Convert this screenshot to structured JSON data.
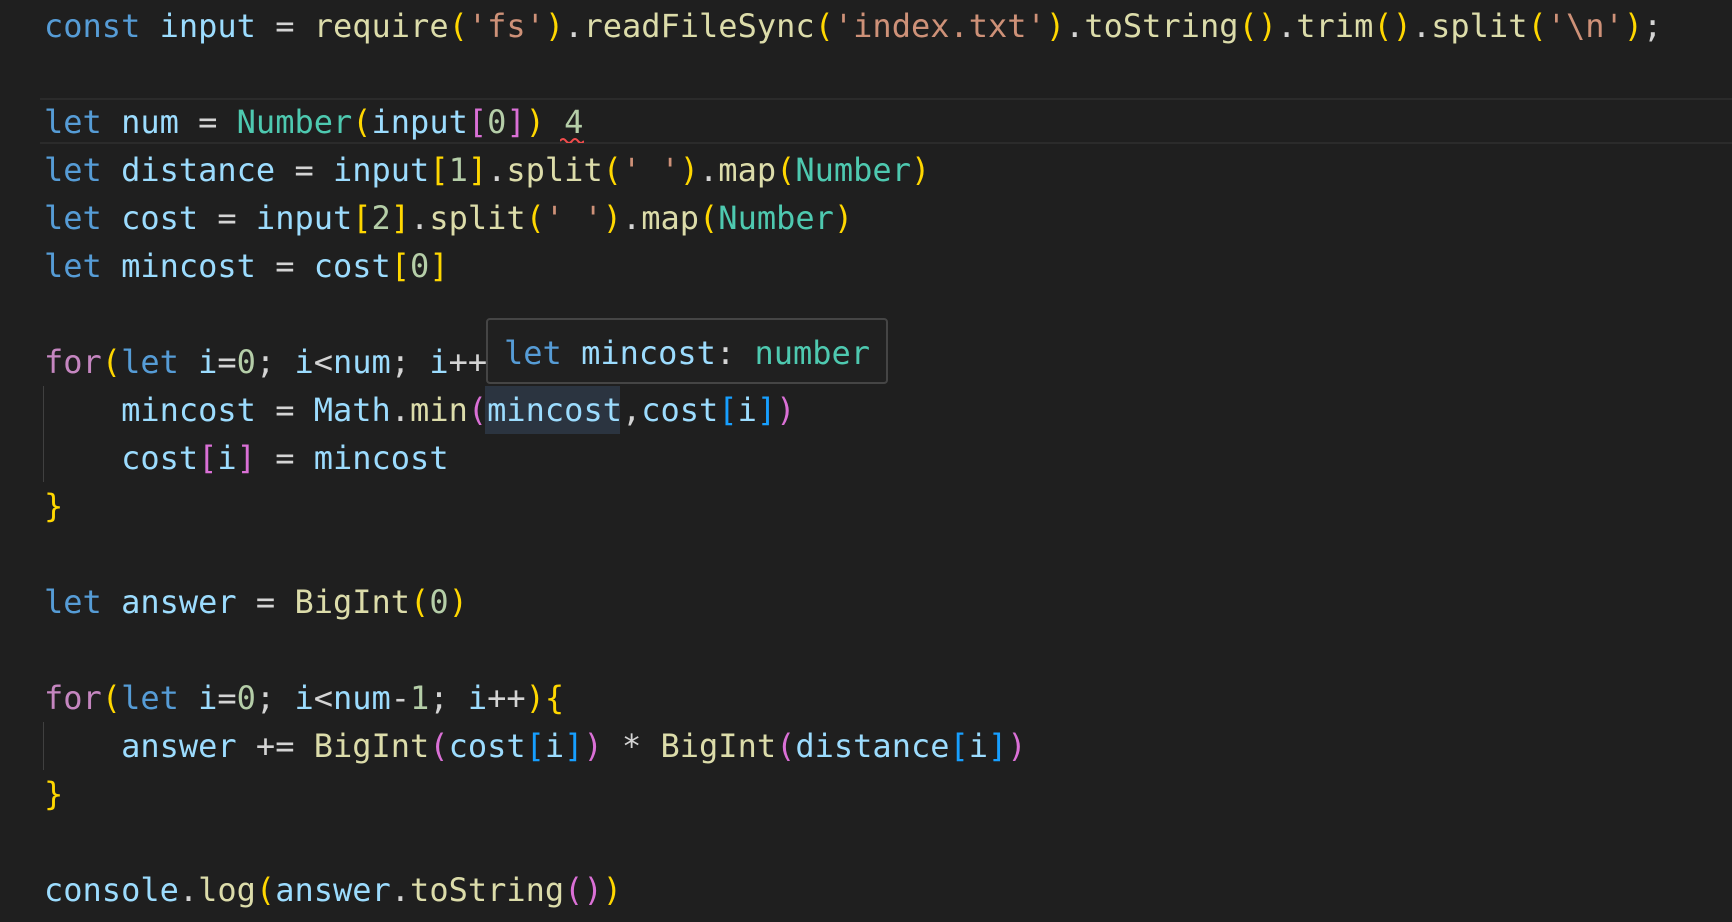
{
  "hover": {
    "keyword": "let",
    "name": "mincost",
    "colon": ":",
    "type": "number"
  },
  "code_lines": [
    "const input = require('fs').readFileSync('index.txt').toString().trim().split('\\n');",
    "",
    "let num = Number(input[0]) 4",
    "let distance = input[1].split(' ').map(Number)",
    "let cost = input[2].split(' ').map(Number)",
    "let mincost = cost[0]",
    "",
    "for(let i=0; i<num; i++",
    "    mincost = Math.min(mincost,cost[i])",
    "    cost[i] = mincost",
    "}",
    "",
    "let answer = BigInt(0)",
    "",
    "for(let i=0; i<num-1; i++){",
    "    answer += BigInt(cost[i]) * BigInt(distance[i])",
    "}",
    "",
    "console.log(answer.toString())"
  ],
  "tokens": [
    [
      {
        "t": "const",
        "c": "kw"
      },
      {
        "t": " ",
        "c": "op"
      },
      {
        "t": "input",
        "c": "var"
      },
      {
        "t": " = ",
        "c": "op"
      },
      {
        "t": "require",
        "c": "fn"
      },
      {
        "t": "(",
        "c": "b1"
      },
      {
        "t": "'fs'",
        "c": "str"
      },
      {
        "t": ")",
        "c": "b1"
      },
      {
        "t": ".",
        "c": "op"
      },
      {
        "t": "readFileSync",
        "c": "fn"
      },
      {
        "t": "(",
        "c": "b1"
      },
      {
        "t": "'index.txt'",
        "c": "str"
      },
      {
        "t": ")",
        "c": "b1"
      },
      {
        "t": ".",
        "c": "op"
      },
      {
        "t": "toString",
        "c": "fn"
      },
      {
        "t": "()",
        "c": "b1"
      },
      {
        "t": ".",
        "c": "op"
      },
      {
        "t": "trim",
        "c": "fn"
      },
      {
        "t": "()",
        "c": "b1"
      },
      {
        "t": ".",
        "c": "op"
      },
      {
        "t": "split",
        "c": "fn"
      },
      {
        "t": "(",
        "c": "b1"
      },
      {
        "t": "'\\n'",
        "c": "str"
      },
      {
        "t": ")",
        "c": "b1"
      },
      {
        "t": ";",
        "c": "op"
      }
    ],
    [],
    [
      {
        "t": "let",
        "c": "kw"
      },
      {
        "t": " ",
        "c": "op"
      },
      {
        "t": "num",
        "c": "var"
      },
      {
        "t": " = ",
        "c": "op"
      },
      {
        "t": "Number",
        "c": "type"
      },
      {
        "t": "(",
        "c": "b1"
      },
      {
        "t": "input",
        "c": "var"
      },
      {
        "t": "[",
        "c": "b2"
      },
      {
        "t": "0",
        "c": "num"
      },
      {
        "t": "]",
        "c": "b2"
      },
      {
        "t": ")",
        "c": "b1"
      },
      {
        "t": " ",
        "c": "op"
      },
      {
        "t": "4",
        "c": "dim"
      }
    ],
    [
      {
        "t": "let",
        "c": "kw"
      },
      {
        "t": " ",
        "c": "op"
      },
      {
        "t": "distance",
        "c": "var"
      },
      {
        "t": " = ",
        "c": "op"
      },
      {
        "t": "input",
        "c": "var"
      },
      {
        "t": "[",
        "c": "b1"
      },
      {
        "t": "1",
        "c": "num"
      },
      {
        "t": "]",
        "c": "b1"
      },
      {
        "t": ".",
        "c": "op"
      },
      {
        "t": "split",
        "c": "fn"
      },
      {
        "t": "(",
        "c": "b1"
      },
      {
        "t": "' '",
        "c": "str"
      },
      {
        "t": ")",
        "c": "b1"
      },
      {
        "t": ".",
        "c": "op"
      },
      {
        "t": "map",
        "c": "fn"
      },
      {
        "t": "(",
        "c": "b1"
      },
      {
        "t": "Number",
        "c": "type"
      },
      {
        "t": ")",
        "c": "b1"
      }
    ],
    [
      {
        "t": "let",
        "c": "kw"
      },
      {
        "t": " ",
        "c": "op"
      },
      {
        "t": "cost",
        "c": "var"
      },
      {
        "t": " = ",
        "c": "op"
      },
      {
        "t": "input",
        "c": "var"
      },
      {
        "t": "[",
        "c": "b1"
      },
      {
        "t": "2",
        "c": "num"
      },
      {
        "t": "]",
        "c": "b1"
      },
      {
        "t": ".",
        "c": "op"
      },
      {
        "t": "split",
        "c": "fn"
      },
      {
        "t": "(",
        "c": "b1"
      },
      {
        "t": "' '",
        "c": "str"
      },
      {
        "t": ")",
        "c": "b1"
      },
      {
        "t": ".",
        "c": "op"
      },
      {
        "t": "map",
        "c": "fn"
      },
      {
        "t": "(",
        "c": "b1"
      },
      {
        "t": "Number",
        "c": "type"
      },
      {
        "t": ")",
        "c": "b1"
      }
    ],
    [
      {
        "t": "let",
        "c": "kw"
      },
      {
        "t": " ",
        "c": "op"
      },
      {
        "t": "mincost",
        "c": "var"
      },
      {
        "t": " = ",
        "c": "op"
      },
      {
        "t": "cost",
        "c": "var"
      },
      {
        "t": "[",
        "c": "b1"
      },
      {
        "t": "0",
        "c": "num"
      },
      {
        "t": "]",
        "c": "b1"
      }
    ],
    [],
    [
      {
        "t": "for",
        "c": "ctl"
      },
      {
        "t": "(",
        "c": "b1"
      },
      {
        "t": "let",
        "c": "kw"
      },
      {
        "t": " ",
        "c": "op"
      },
      {
        "t": "i",
        "c": "var"
      },
      {
        "t": "=",
        "c": "op"
      },
      {
        "t": "0",
        "c": "num"
      },
      {
        "t": "; ",
        "c": "op"
      },
      {
        "t": "i",
        "c": "var"
      },
      {
        "t": "<",
        "c": "op"
      },
      {
        "t": "num",
        "c": "var"
      },
      {
        "t": "; ",
        "c": "op"
      },
      {
        "t": "i",
        "c": "var"
      },
      {
        "t": "++",
        "c": "op"
      }
    ],
    [
      {
        "t": "    ",
        "c": "op"
      },
      {
        "t": "mincost",
        "c": "var"
      },
      {
        "t": " = ",
        "c": "op"
      },
      {
        "t": "Math",
        "c": "var"
      },
      {
        "t": ".",
        "c": "op"
      },
      {
        "t": "min",
        "c": "fn"
      },
      {
        "t": "(",
        "c": "b2"
      },
      {
        "t": "mincost",
        "c": "var"
      },
      {
        "t": ",",
        "c": "op"
      },
      {
        "t": "cost",
        "c": "var"
      },
      {
        "t": "[",
        "c": "b3"
      },
      {
        "t": "i",
        "c": "var"
      },
      {
        "t": "]",
        "c": "b3"
      },
      {
        "t": ")",
        "c": "b2"
      }
    ],
    [
      {
        "t": "    ",
        "c": "op"
      },
      {
        "t": "cost",
        "c": "var"
      },
      {
        "t": "[",
        "c": "b2"
      },
      {
        "t": "i",
        "c": "var"
      },
      {
        "t": "]",
        "c": "b2"
      },
      {
        "t": " = ",
        "c": "op"
      },
      {
        "t": "mincost",
        "c": "var"
      }
    ],
    [
      {
        "t": "}",
        "c": "b1"
      }
    ],
    [],
    [
      {
        "t": "let",
        "c": "kw"
      },
      {
        "t": " ",
        "c": "op"
      },
      {
        "t": "answer",
        "c": "var"
      },
      {
        "t": " = ",
        "c": "op"
      },
      {
        "t": "BigInt",
        "c": "fn"
      },
      {
        "t": "(",
        "c": "b1"
      },
      {
        "t": "0",
        "c": "num"
      },
      {
        "t": ")",
        "c": "b1"
      }
    ],
    [],
    [
      {
        "t": "for",
        "c": "ctl"
      },
      {
        "t": "(",
        "c": "b1"
      },
      {
        "t": "let",
        "c": "kw"
      },
      {
        "t": " ",
        "c": "op"
      },
      {
        "t": "i",
        "c": "var"
      },
      {
        "t": "=",
        "c": "op"
      },
      {
        "t": "0",
        "c": "num"
      },
      {
        "t": "; ",
        "c": "op"
      },
      {
        "t": "i",
        "c": "var"
      },
      {
        "t": "<",
        "c": "op"
      },
      {
        "t": "num",
        "c": "var"
      },
      {
        "t": "-",
        "c": "op"
      },
      {
        "t": "1",
        "c": "num"
      },
      {
        "t": "; ",
        "c": "op"
      },
      {
        "t": "i",
        "c": "var"
      },
      {
        "t": "++",
        "c": "op"
      },
      {
        "t": ")",
        "c": "b1"
      },
      {
        "t": "{",
        "c": "b1"
      }
    ],
    [
      {
        "t": "    ",
        "c": "op"
      },
      {
        "t": "answer",
        "c": "var"
      },
      {
        "t": " += ",
        "c": "op"
      },
      {
        "t": "BigInt",
        "c": "fn"
      },
      {
        "t": "(",
        "c": "b2"
      },
      {
        "t": "cost",
        "c": "var"
      },
      {
        "t": "[",
        "c": "b3"
      },
      {
        "t": "i",
        "c": "var"
      },
      {
        "t": "]",
        "c": "b3"
      },
      {
        "t": ")",
        "c": "b2"
      },
      {
        "t": " * ",
        "c": "op"
      },
      {
        "t": "BigInt",
        "c": "fn"
      },
      {
        "t": "(",
        "c": "b2"
      },
      {
        "t": "distance",
        "c": "var"
      },
      {
        "t": "[",
        "c": "b3"
      },
      {
        "t": "i",
        "c": "var"
      },
      {
        "t": "]",
        "c": "b3"
      },
      {
        "t": ")",
        "c": "b2"
      }
    ],
    [
      {
        "t": "}",
        "c": "b1"
      }
    ],
    [],
    [
      {
        "t": "console",
        "c": "var"
      },
      {
        "t": ".",
        "c": "op"
      },
      {
        "t": "log",
        "c": "fn"
      },
      {
        "t": "(",
        "c": "b1"
      },
      {
        "t": "answer",
        "c": "var"
      },
      {
        "t": ".",
        "c": "op"
      },
      {
        "t": "toString",
        "c": "fn"
      },
      {
        "t": "()",
        "c": "b2"
      },
      {
        "t": ")",
        "c": "b1"
      }
    ]
  ],
  "colors": {
    "background": "#1f1f1f",
    "keyword": "#569cd6",
    "control": "#c586c0",
    "variable": "#9cdcfe",
    "function": "#dcdcaa",
    "string": "#ce9178",
    "number": "#b5cea8",
    "type": "#4ec9b0",
    "bracket_1": "#ffd700",
    "bracket_2": "#da70d6",
    "bracket_3": "#179fff",
    "error_squiggle": "#f14c4c"
  }
}
